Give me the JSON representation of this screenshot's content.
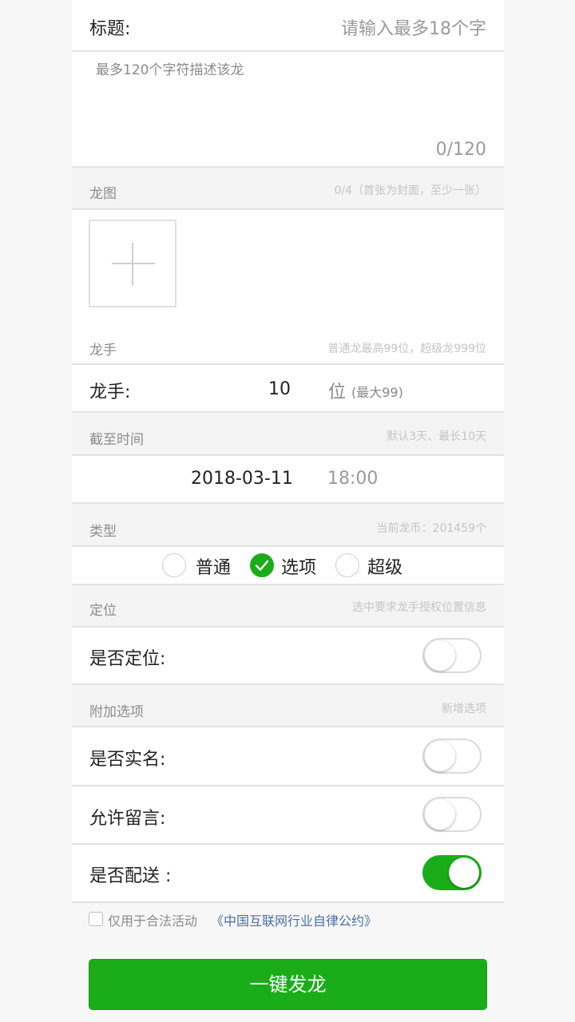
{
  "form": {
    "title_label": "标题:",
    "title_placeholder": "请输入最多18个字",
    "desc_placeholder": "最多120个字符描述该龙",
    "desc_counter": "0/120"
  },
  "images": {
    "header": "龙图",
    "hint": "0/4（首张为封面，至少一张）",
    "sub_header": "龙手",
    "sub_hint": "普通龙最高99位，超级龙999位"
  },
  "participants": {
    "label": "龙手:",
    "value": "10",
    "unit": "位",
    "max_note": "(最大99)"
  },
  "deadline": {
    "header": "截至时间",
    "hint": "默认3天、最长10天",
    "date": "2018-03-11",
    "time": "18:00"
  },
  "type": {
    "header": "类型",
    "hint": "当前龙币：201459个",
    "options": [
      "普通",
      "选项",
      "超级"
    ],
    "selected": "选项"
  },
  "location": {
    "header": "定位",
    "hint": "选中要求龙手授权位置信息",
    "label": "是否定位:",
    "enabled": false
  },
  "extras": {
    "header": "附加选项",
    "hint": "新增选项",
    "items": [
      {
        "label": "是否实名:",
        "enabled": false
      },
      {
        "label": "允许留言:",
        "enabled": false
      },
      {
        "label": "是否配送 :",
        "enabled": true
      }
    ]
  },
  "agreement": {
    "text": "仅用于合法活动",
    "link": "《中国互联网行业自律公约》",
    "checked": false
  },
  "submit_label": "一键发龙",
  "colors": {
    "accent": "#1aad19",
    "link": "#4a6fa5"
  },
  "icons": {
    "add_image": "plus-icon",
    "radio_check": "check-icon"
  }
}
